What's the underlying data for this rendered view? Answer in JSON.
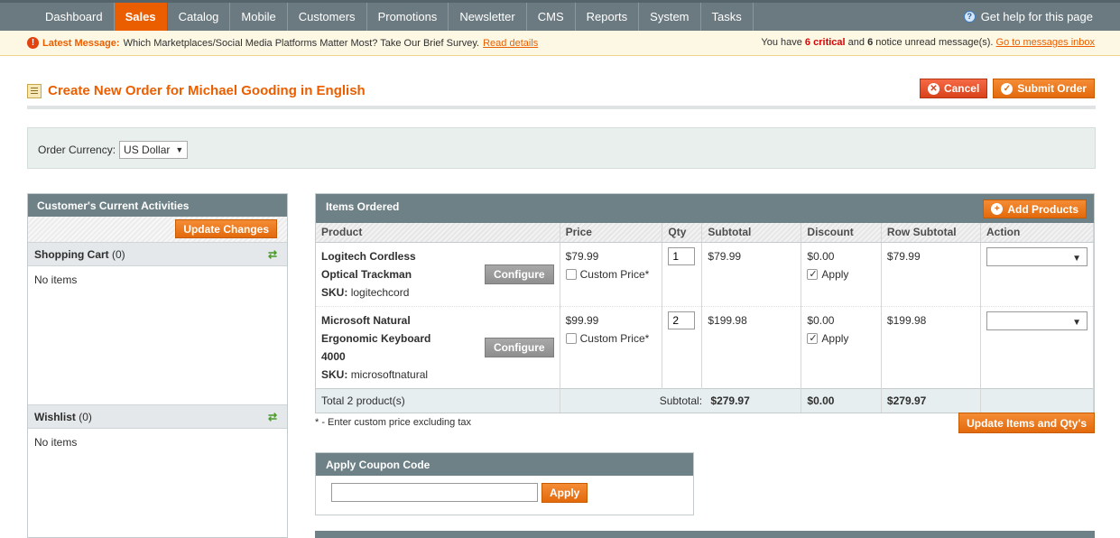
{
  "nav": {
    "items": [
      {
        "label": "Dashboard"
      },
      {
        "label": "Sales"
      },
      {
        "label": "Catalog"
      },
      {
        "label": "Mobile"
      },
      {
        "label": "Customers"
      },
      {
        "label": "Promotions"
      },
      {
        "label": "Newsletter"
      },
      {
        "label": "CMS"
      },
      {
        "label": "Reports"
      },
      {
        "label": "System"
      },
      {
        "label": "Tasks"
      }
    ],
    "active": "Sales",
    "help_label": "Get help for this page"
  },
  "message": {
    "latest_label": "Latest Message:",
    "text": "Which Marketplaces/Social Media Platforms Matter Most? Take Our Brief Survey.",
    "read_link": "Read details",
    "summary_prefix": "You have",
    "critical_count": "6",
    "critical_label": "critical",
    "and_label": "and",
    "notice_count": "6",
    "summary_suffix": "notice unread message(s).",
    "inbox_link": "Go to messages inbox"
  },
  "header": {
    "title": "Create New Order for Michael Gooding in English",
    "cancel_label": "Cancel",
    "submit_label": "Submit Order"
  },
  "currency": {
    "label": "Order Currency:",
    "value": "US Dollar"
  },
  "sidebar": {
    "title": "Customer's Current Activities",
    "update_label": "Update Changes",
    "cart_title": "Shopping Cart",
    "cart_count": "(0)",
    "cart_empty": "No items",
    "wishlist_title": "Wishlist",
    "wishlist_count": "(0)",
    "wishlist_empty": "No items"
  },
  "items": {
    "title": "Items Ordered",
    "add_label": "Add Products",
    "columns": [
      "Product",
      "Price",
      "Qty",
      "Subtotal",
      "Discount",
      "Row Subtotal",
      "Action"
    ],
    "rows": [
      {
        "name_line1": "Logitech Cordless",
        "name_line2": "Optical Trackman",
        "sku_label": "SKU:",
        "sku": "logitechcord",
        "configure": "Configure",
        "price": "$79.99",
        "custom_price": "Custom Price*",
        "qty": "1",
        "subtotal": "$79.99",
        "discount": "$0.00",
        "apply": "Apply",
        "row_subtotal": "$79.99"
      },
      {
        "name_line1": "Microsoft Natural",
        "name_line2": "Ergonomic Keyboard",
        "name_line3": "4000",
        "sku_label": "SKU:",
        "sku": "microsoftnatural",
        "configure": "Configure",
        "price": "$99.99",
        "custom_price": "Custom Price*",
        "qty": "2",
        "subtotal": "$199.98",
        "discount": "$0.00",
        "apply": "Apply",
        "row_subtotal": "$199.98"
      }
    ],
    "footer": {
      "total_label": "Total 2 product(s)",
      "subtotal_label": "Subtotal:",
      "subtotal": "$279.97",
      "discount": "$0.00",
      "row_subtotal": "$279.97"
    },
    "note": "* - Enter custom price excluding tax",
    "update_label": "Update Items and Qty's"
  },
  "coupon": {
    "title": "Apply Coupon Code",
    "input_value": "",
    "apply_label": "Apply"
  },
  "colors": {
    "accent": "#eb5e00",
    "nav_bg": "#6b7a80",
    "section_header": "#6e8186"
  }
}
